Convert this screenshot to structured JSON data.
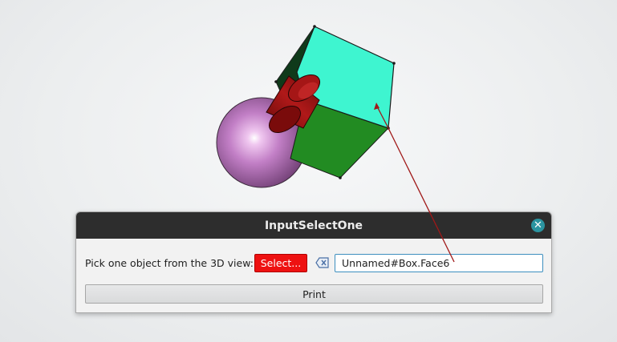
{
  "dialog": {
    "title": "InputSelectOne",
    "prompt": "Pick one object from the 3D view:",
    "select_label": "Select...",
    "selection_value": "Unnamed#Box.Face6",
    "print_label": "Print",
    "close_icon": "close-icon",
    "clear_icon": "clear-selection-icon"
  },
  "colors": {
    "select_button": "#ee1111",
    "titlebar": "#2d2d2d",
    "close_button": "#2b94a0",
    "box_top_face": "#3ef5d0",
    "box_side_face": "#228b22",
    "sphere": "#c27fc6",
    "cylinder": "#9b1212",
    "pointer_line": "#a01818"
  }
}
